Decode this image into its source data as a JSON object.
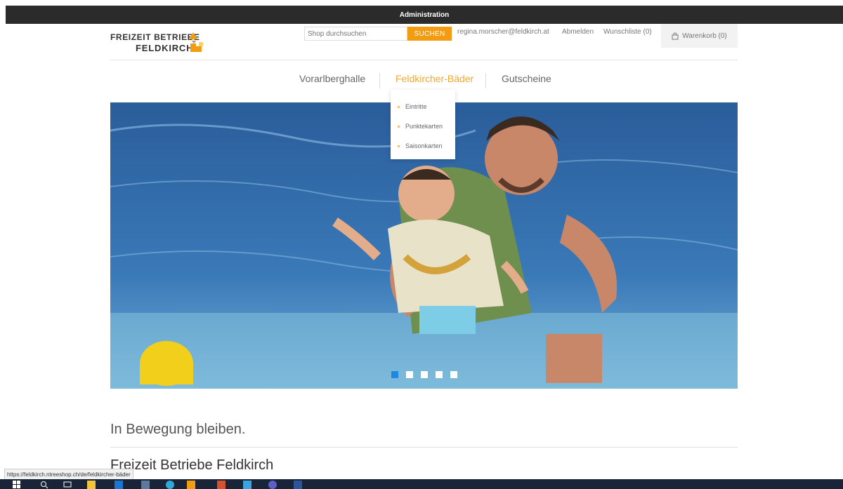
{
  "admin_bar": {
    "label": "Administration"
  },
  "header": {
    "logo_line1": "FREIZEIT BETRIEBE",
    "logo_line2": "FELDKIRCH",
    "search_placeholder": "Shop durchsuchen",
    "search_button": "SUCHEN",
    "user_email": "regina.morscher@feldkirch.at",
    "logout": "Abmelden",
    "wishlist": "Wunschliste (0)",
    "cart": "Warenkorb (0)"
  },
  "nav": {
    "items": [
      {
        "label": "Vorarlberghalle"
      },
      {
        "label": "Feldkircher-Bäder",
        "active": true
      },
      {
        "label": "Gutscheine"
      }
    ],
    "dropdown": [
      "Eintritte",
      "Punktekarten",
      "Saisonkarten"
    ]
  },
  "slider": {
    "slide_count": 5,
    "active_index": 0
  },
  "content": {
    "tagline": "In Bewegung bleiben.",
    "subtitle": "Freizeit Betriebe Feldkirch"
  },
  "status_bar": {
    "url": "https://feldkirch.ntreeshop.ch/de/feldkircher-bäder"
  },
  "colors": {
    "accent": "#f39c12",
    "admin_bar": "#2b2b2b",
    "slider_active": "#1e88e5"
  },
  "taskbar_icons": [
    "windows-icon",
    "search-icon",
    "task-view-icon",
    "file-explorer-icon",
    "outlook-icon",
    "calculator-icon",
    "edge-icon",
    "chrome-icon",
    "powerpoint-icon",
    "app-icon",
    "teams-icon",
    "word-icon"
  ]
}
